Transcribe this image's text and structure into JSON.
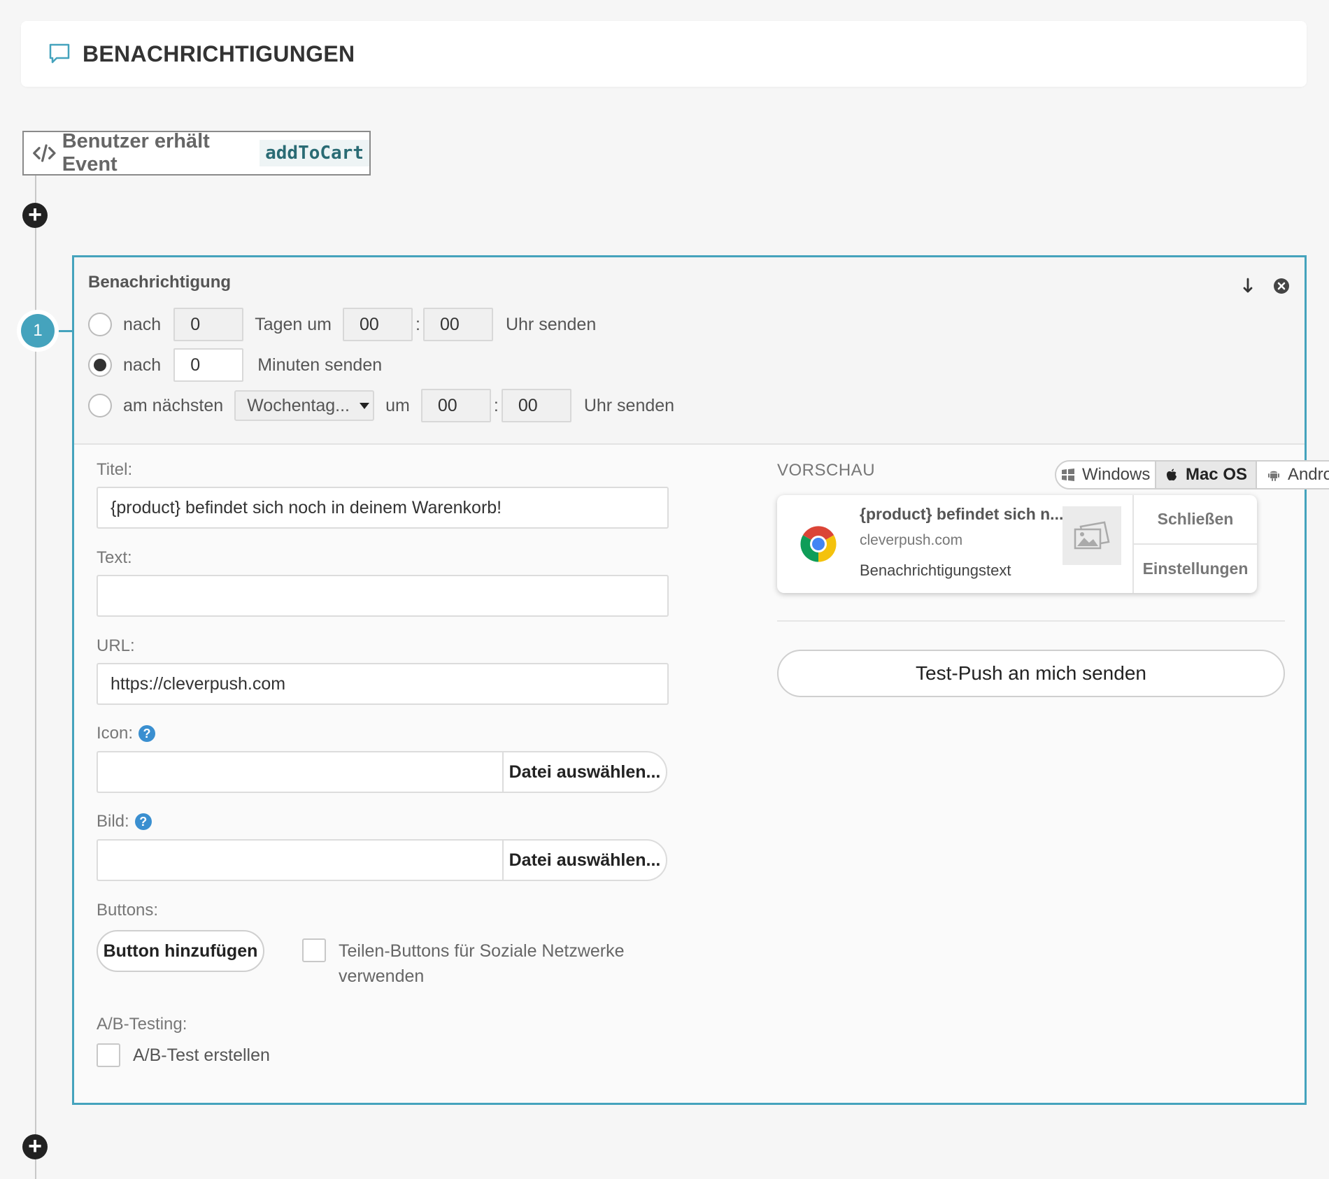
{
  "header": {
    "title": "BENACHRICHTIGUNGEN",
    "icon": "chat-bubble-icon"
  },
  "trigger": {
    "label": "Benutzer erhält Event",
    "event": "addToCart",
    "icon": "code-icon"
  },
  "step": {
    "number": "1"
  },
  "card": {
    "title": "Benachrichtigung",
    "schedule": {
      "row1": {
        "prefix": "nach",
        "days": "0",
        "days_label": "Tagen um",
        "hour": "00",
        "sep": ":",
        "minute": "00",
        "suffix": "Uhr senden",
        "checked": false
      },
      "row2": {
        "prefix": "nach",
        "minutes": "0",
        "suffix": "Minuten senden",
        "checked": true
      },
      "row3": {
        "prefix": "am nächsten",
        "weekday": "Wochentag...",
        "um": "um",
        "hour": "00",
        "sep": ":",
        "minute": "00",
        "suffix": "Uhr senden",
        "checked": false
      }
    },
    "form": {
      "title_label": "Titel:",
      "title_value": "{product} befindet sich noch in deinem Warenkorb!",
      "text_label": "Text:",
      "text_value": "",
      "url_label": "URL:",
      "url_value": "https://cleverpush.com",
      "icon_label": "Icon:",
      "image_label": "Bild:",
      "file_button": "Datei auswählen...",
      "help": "?",
      "buttons_label": "Buttons:",
      "add_button": "Button hinzufügen",
      "share_label": "Teilen-Buttons für Soziale Netzwerke verwenden",
      "ab_label": "A/B-Testing:",
      "ab_checkbox": "A/B-Test erstellen"
    },
    "preview": {
      "label": "VORSCHAU",
      "os_tabs": [
        {
          "label": "Windows",
          "icon": "windows-icon",
          "active": false
        },
        {
          "label": "Mac OS",
          "icon": "apple-icon",
          "active": true
        },
        {
          "label": "Android",
          "icon": "android-icon",
          "active": false
        }
      ],
      "notification": {
        "title": "{product} befindet sich n...",
        "site": "cleverpush.com",
        "text": "Benachrichtigungstext",
        "actions": [
          "Schließen",
          "Einstellungen"
        ]
      },
      "test_button": "Test-Push an mich senden"
    }
  },
  "colors": {
    "accent": "#45a3bd",
    "help": "#3a8fd0",
    "event_code": "#2a6b74"
  }
}
